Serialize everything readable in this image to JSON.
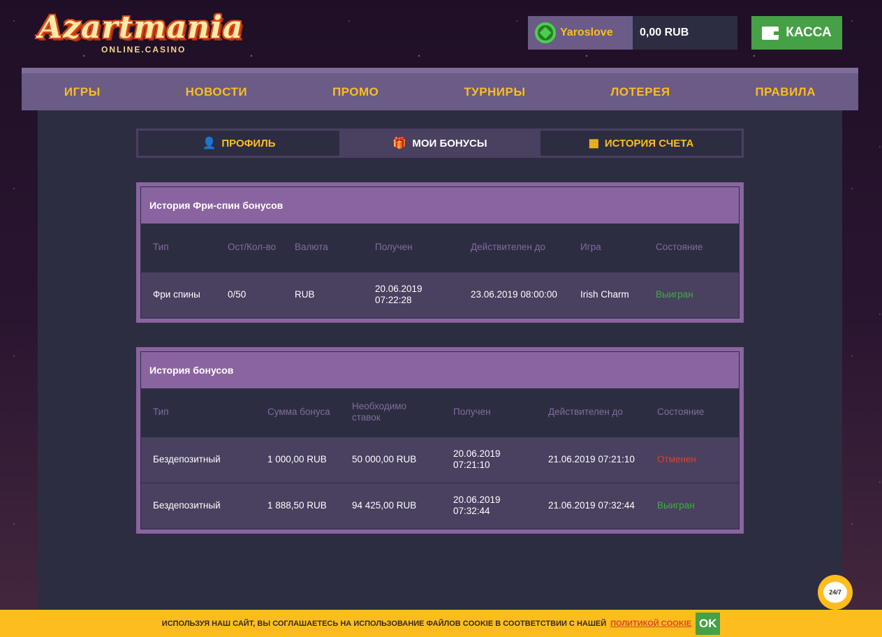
{
  "logo": {
    "main": "Azartmania",
    "sub": "ONLINE.CASINO"
  },
  "user": {
    "name": "Yaroslove",
    "balance": "0,00 RUB"
  },
  "kassa": "КАССА",
  "nav": [
    "ИГРЫ",
    "НОВОСТИ",
    "ПРОМО",
    "ТУРНИРЫ",
    "ЛОТЕРЕЯ",
    "ПРАВИЛА"
  ],
  "tabs": [
    {
      "label": "ПРОФИЛЬ",
      "icon": "user-icon"
    },
    {
      "label": "МОИ БОНУСЫ",
      "icon": "gift-icon"
    },
    {
      "label": "ИСТОРИЯ СЧЕТА",
      "icon": "calculator-icon"
    }
  ],
  "freespins": {
    "title": "История Фри-спин бонусов",
    "headers": [
      "Тип",
      "Ост/Кол-во",
      "Валюта",
      "Получен",
      "Действителен до",
      "Игра",
      "Состояние"
    ],
    "rows": [
      [
        "Фри спины",
        "0/50",
        "RUB",
        "20.06.2019 07:22:28",
        "23.06.2019 08:00:00",
        "Irish Charm",
        "Выигран"
      ]
    ]
  },
  "bonuses": {
    "title": "История бонусов",
    "headers": [
      "Тип",
      "Сумма бонуса",
      "Необходимо ставок",
      "Получен",
      "Действителен до",
      "Состояние"
    ],
    "rows": [
      [
        "Бездепозитный",
        "1 000,00 RUB",
        "50 000,00 RUB",
        "20.06.2019 07:21:10",
        "21.06.2019 07:21:10",
        "Отменен"
      ],
      [
        "Бездепозитный",
        "1 888,50 RUB",
        "94 425,00 RUB",
        "20.06.2019 07:32:44",
        "21.06.2019 07:32:44",
        "Выигран"
      ]
    ]
  },
  "cookie": {
    "text": "ИСПОЛЬЗУЯ НАШ САЙТ, ВЫ СОГЛАШАЕТЕСЬ НА ИСПОЛЬЗОВАНИЕ ФАЙЛОВ COOKIE В СООТВЕТСТВИИ С НАШЕЙ",
    "link": "ПОЛИТИКОЙ COOKIE",
    "ok": "OK"
  },
  "chat": "24/7",
  "colors": {
    "accent": "#fdbd1e",
    "green": "#46a046",
    "panel": "#8a64a0",
    "dark": "#2d2d42"
  }
}
